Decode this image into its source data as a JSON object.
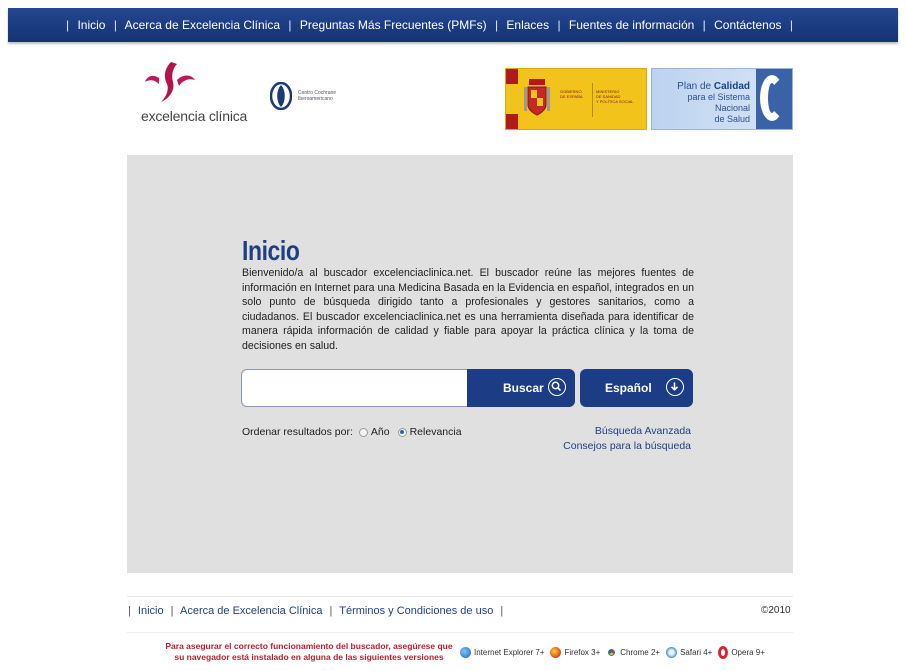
{
  "topnav": {
    "items": [
      "Inicio",
      "Acerca de Excelencia Clínica",
      "Preguntas Más Frecuentes (PMFs)",
      "Enlaces",
      "Fuentes de información",
      "Contáctenos"
    ]
  },
  "logos": {
    "excelencia": "excelencia clínica",
    "cochrane": "Centro Cochrane\nIberoamericano",
    "gobierno": "GOBIERNO\nDE ESPAÑA",
    "ministerio": "MINISTERIO\nDE SANIDAD\nY POLÍTICA SOCIAL",
    "plan_line1_a": "Plan de",
    "plan_line1_b": "Calidad",
    "plan_line2": "para el Sistema Nacional",
    "plan_line3": "de Salud"
  },
  "main": {
    "title": "Inicio",
    "intro": "Bienvenido/a al buscador excelenciaclinica.net. El buscador reúne las mejores fuentes de información en Internet para una Medicina Basada en la Evidencia en español, integrados en un solo punto de búsqueda dirigido tanto a profesionales y gestores sanitarios, como a ciudadanos. El buscador excelenciaclinica.net es una herramienta diseñada para identificar de manera rápida información de calidad y fiable para apoyar la práctica clínica y la toma de decisiones en salud."
  },
  "search": {
    "value": "",
    "placeholder": "",
    "button_label": "Buscar",
    "language": "Español"
  },
  "sort": {
    "label": "Ordenar resultados por:",
    "options": [
      {
        "label": "Año",
        "selected": false
      },
      {
        "label": "Relevancia",
        "selected": true
      }
    ]
  },
  "links": {
    "advanced": "Búsqueda Avanzada",
    "tips": "Consejos para la búsqueda"
  },
  "footer": {
    "nav": [
      "Inicio",
      "Acerca de Excelencia Clínica",
      "Términos y Condiciones de uso"
    ],
    "copyright": "©2010",
    "warning": "Para asegurar el correcto funcionamiento del buscador, asegúrese que su navegador está instalado en alguna de las siguientes versiones",
    "browsers": [
      {
        "name": "Internet Explorer 7+",
        "icon": "internet-explorer-icon"
      },
      {
        "name": "Firefox 3+",
        "icon": "firefox-icon"
      },
      {
        "name": "Chrome 2+",
        "icon": "chrome-icon"
      },
      {
        "name": "Safari 4+",
        "icon": "safari-icon"
      },
      {
        "name": "Opera 9+",
        "icon": "opera-icon"
      }
    ]
  },
  "colors": {
    "nav_bg": "#1a3a80",
    "title": "#1f3f85",
    "panel_bg": "#e0e0e0",
    "button_bg": "#1c3c86",
    "warning": "#b8202c"
  }
}
